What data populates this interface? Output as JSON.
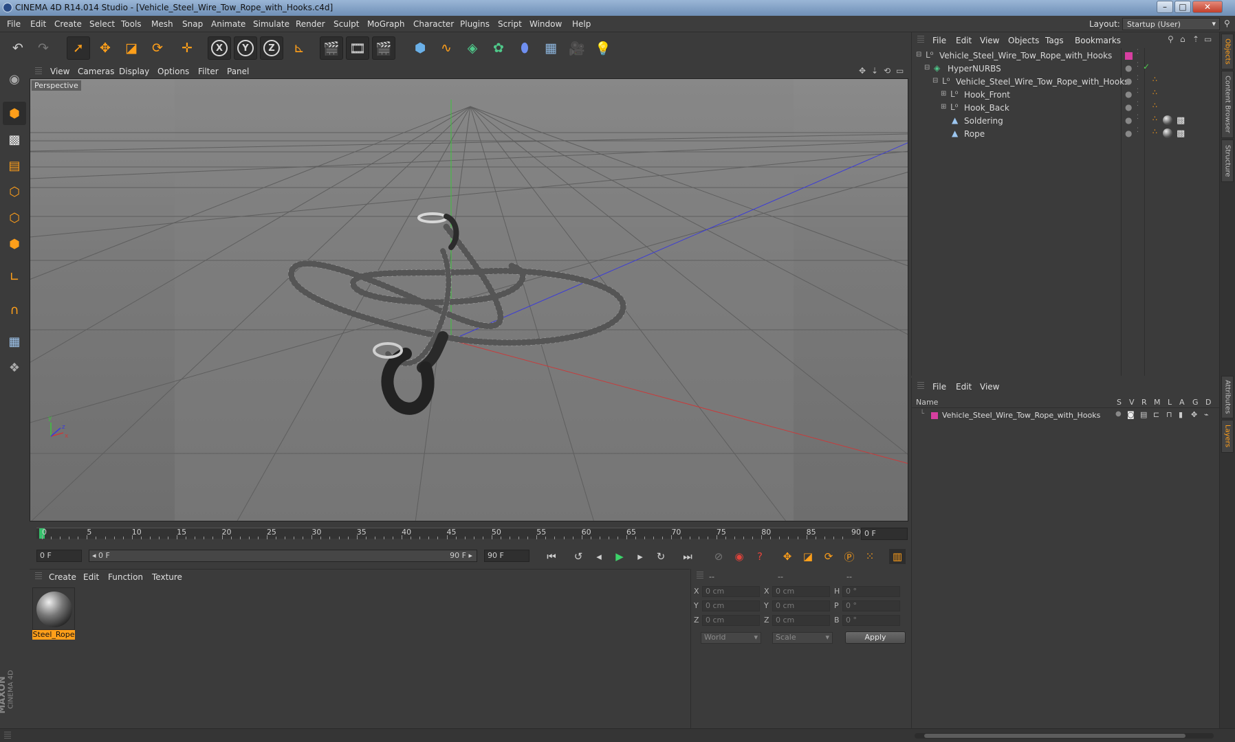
{
  "window": {
    "title": "CINEMA 4D R14.014 Studio - [Vehicle_Steel_Wire_Tow_Rope_with_Hooks.c4d]",
    "minimize": "–",
    "maximize": "□",
    "close": "✕"
  },
  "menubar": [
    "File",
    "Edit",
    "Create",
    "Select",
    "Tools",
    "Mesh",
    "Snap",
    "Animate",
    "Simulate",
    "Render",
    "Sculpt",
    "MoGraph",
    "Character",
    "Plugins",
    "Script",
    "Window",
    "Help"
  ],
  "layout": {
    "label": "Layout:",
    "value": "Startup (User)"
  },
  "toolbar": {
    "axis_x": "X",
    "axis_y": "Y",
    "axis_z": "Z"
  },
  "viewport": {
    "menu": [
      "View",
      "Cameras",
      "Display",
      "Options",
      "Filter",
      "Panel"
    ],
    "camera_label": "Perspective",
    "axis_y": "y",
    "axis_z": "z",
    "axis_x": "x"
  },
  "timeline": {
    "ticks": [
      "0",
      "5",
      "10",
      "15",
      "20",
      "25",
      "30",
      "35",
      "40",
      "45",
      "50",
      "55",
      "60",
      "65",
      "70",
      "75",
      "80",
      "85",
      "90"
    ],
    "current_frame": "0 F"
  },
  "transport": {
    "start_field": "0 F",
    "range_start": "◂ 0 F",
    "range_end": "90 F ▸",
    "end_field": "90 F"
  },
  "material_manager": {
    "menu": [
      "Create",
      "Edit",
      "Function",
      "Texture"
    ],
    "materials": [
      {
        "name": "Steel_Rope"
      }
    ]
  },
  "coordinates": {
    "header": [
      "--",
      "--",
      "--"
    ],
    "rows": [
      {
        "a_label": "X",
        "a_value": "0 cm",
        "b_label": "X",
        "b_value": "0 cm",
        "c_label": "H",
        "c_value": "0 °"
      },
      {
        "a_label": "Y",
        "a_value": "0 cm",
        "b_label": "Y",
        "b_value": "0 cm",
        "c_label": "P",
        "c_value": "0 °"
      },
      {
        "a_label": "Z",
        "a_value": "0 cm",
        "b_label": "Z",
        "b_value": "0 cm",
        "c_label": "B",
        "c_value": "0 °"
      }
    ],
    "space_select": "World",
    "mode_select": "Scale",
    "apply_label": "Apply"
  },
  "object_manager": {
    "menu": [
      "File",
      "Edit",
      "View",
      "Objects",
      "Tags",
      "Bookmarks"
    ],
    "objects": [
      {
        "name": "Vehicle_Steel_Wire_Tow_Rope_with_Hooks"
      },
      {
        "name": "HyperNURBS"
      },
      {
        "name": "Vehicle_Steel_Wire_Tow_Rope_with_Hooks"
      },
      {
        "name": "Hook_Front"
      },
      {
        "name": "Hook_Back"
      },
      {
        "name": "Soldering"
      },
      {
        "name": "Rope"
      }
    ]
  },
  "layer_manager": {
    "menu": [
      "File",
      "Edit",
      "View"
    ],
    "columns": {
      "name": "Name",
      "flags": [
        "S",
        "V",
        "R",
        "M",
        "L",
        "A",
        "G",
        "D"
      ]
    },
    "layers": [
      {
        "name": "Vehicle_Steel_Wire_Tow_Rope_with_Hooks"
      }
    ]
  },
  "side_tabs": [
    "Objects",
    "Content Browser",
    "Structure",
    "Attributes",
    "Layers"
  ],
  "branding": {
    "maxon": "MAXON",
    "cinema": "CINEMA 4D"
  },
  "colors": {
    "accent": "#ff9f1a",
    "layer_color": "#d63fa0",
    "bg": "#3b3b3b"
  }
}
